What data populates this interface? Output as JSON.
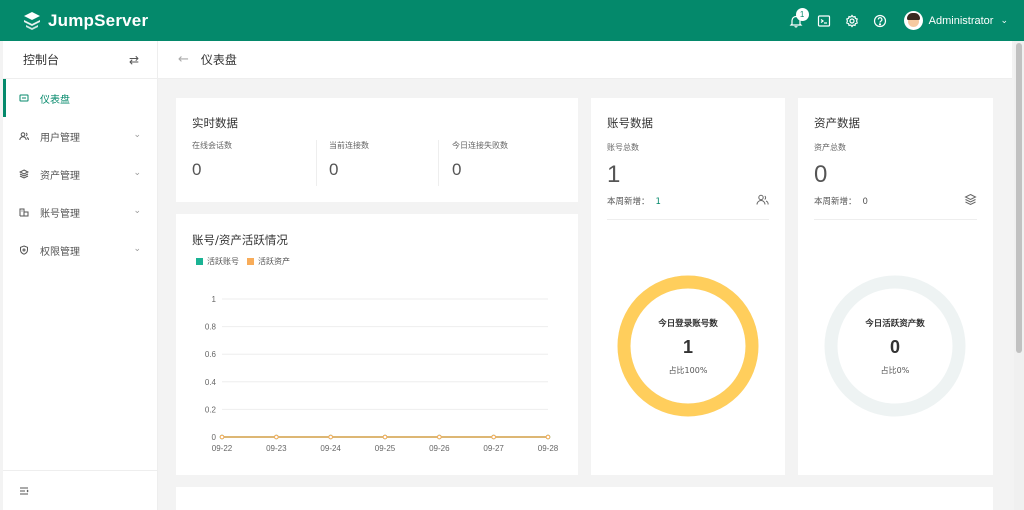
{
  "app": {
    "logo_text": "JumpServer"
  },
  "topbar": {
    "notification_count": "1",
    "username": "Administrator"
  },
  "sidebar": {
    "title": "控制台",
    "items": [
      {
        "label": "仪表盘",
        "icon": "dashboard-icon",
        "active": true
      },
      {
        "label": "用户管理",
        "icon": "users-icon"
      },
      {
        "label": "资产管理",
        "icon": "layers-icon"
      },
      {
        "label": "账号管理",
        "icon": "account-icon"
      },
      {
        "label": "权限管理",
        "icon": "shield-icon"
      }
    ]
  },
  "page": {
    "title": "仪表盘"
  },
  "realtime": {
    "title": "实时数据",
    "cells": [
      {
        "label": "在线会话数",
        "value": "0"
      },
      {
        "label": "当前连接数",
        "value": "0"
      },
      {
        "label": "今日连接失败数",
        "value": "0"
      }
    ]
  },
  "activity": {
    "title": "账号/资产活跃情况",
    "legend": [
      "活跃账号",
      "活跃资产"
    ]
  },
  "chart_data": {
    "type": "line",
    "x": [
      "09-22",
      "09-23",
      "09-24",
      "09-25",
      "09-26",
      "09-27",
      "09-28"
    ],
    "series": [
      {
        "name": "活跃账号",
        "values": [
          0,
          0,
          0,
          0,
          0,
          0,
          0
        ],
        "color": "#1ab394"
      },
      {
        "name": "活跃资产",
        "values": [
          0,
          0,
          0,
          0,
          0,
          0,
          0
        ],
        "color": "#f8ac59"
      }
    ],
    "yticks": [
      "0",
      "0.2",
      "0.4",
      "0.6",
      "0.8",
      "1"
    ],
    "ylim": [
      0,
      1
    ],
    "grid": true,
    "legend_position": "top-left"
  },
  "accounts": {
    "title": "账号数据",
    "total_label": "账号总数",
    "total_value": "1",
    "week_label": "本周新增：",
    "week_value": "1",
    "donut_label": "今日登录账号数",
    "donut_value": "1",
    "donut_ratio": "占比100%",
    "donut_fraction": 1.0,
    "donut_color": "#ffce5c"
  },
  "assets": {
    "title": "资产数据",
    "total_label": "资产总数",
    "total_value": "0",
    "week_label": "本周新增：",
    "week_value": "0",
    "donut_label": "今日活跃资产数",
    "donut_value": "0",
    "donut_ratio": "占比0%",
    "donut_fraction": 0.0,
    "donut_color": "#ffce5c"
  },
  "bottom_card": {
    "title": ""
  },
  "colors": {
    "brand": "#04896b",
    "track": "#eef3f3"
  }
}
